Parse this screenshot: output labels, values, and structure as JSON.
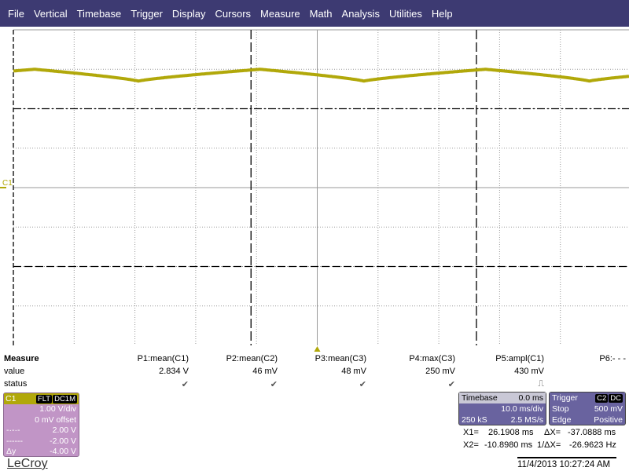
{
  "menu": [
    "File",
    "Vertical",
    "Timebase",
    "Trigger",
    "Display",
    "Cursors",
    "Measure",
    "Math",
    "Analysis",
    "Utilities",
    "Help"
  ],
  "trace": {
    "label": "C1",
    "color": "#b1a80a",
    "volts_per_div": 1.0,
    "ms_per_div": 10.0,
    "peak_v": 3.0,
    "min_v": 2.7,
    "period_ms": 37.1
  },
  "measure": {
    "title": "Measure",
    "value_label": "value",
    "status_label": "status",
    "params": [
      {
        "name": "P1:mean(C1)",
        "value": "2.834 V",
        "status": "✔"
      },
      {
        "name": "P2:mean(C2)",
        "value": "46 mV",
        "status": "✔"
      },
      {
        "name": "P3:mean(C3)",
        "value": "48 mV",
        "status": "✔"
      },
      {
        "name": "P4:max(C3)",
        "value": "250 mV",
        "status": "✔"
      },
      {
        "name": "P5:ampl(C1)",
        "value": "430 mV",
        "status": "⎍"
      },
      {
        "name": "P6:- - -",
        "value": "",
        "status": ""
      }
    ]
  },
  "channel": {
    "name": "C1",
    "badge1": "FLT",
    "badge2": "DC1M",
    "vdiv": "1.00 V/div",
    "offset": "0 mV offset",
    "c1_sym": "-·-·-",
    "c1": "2.00 V",
    "c2_sym": "------",
    "c2": "-2.00 V",
    "dy_label": "Δy",
    "dy": "-4.00 V"
  },
  "timebase": {
    "title": "Timebase",
    "delay": "0.0 ms",
    "tdiv": "10.0 ms/div",
    "samples": "250 kS",
    "rate": "2.5 MS/s"
  },
  "trigger": {
    "title": "Trigger",
    "src": "C2",
    "coupling": "DC",
    "mode": "Stop",
    "level": "500 mV",
    "type": "Edge",
    "slope": "Positive"
  },
  "cursors": {
    "x1_label": "X1=",
    "x1": "26.1908 ms",
    "dx_label": "ΔX=",
    "dx": "-37.0888 ms",
    "x2_label": "X2=",
    "x2": "-10.8980 ms",
    "inv_label": "1/ΔX=",
    "inv": "-26.9623 Hz"
  },
  "brand": "LeCroy",
  "datetime": "11/4/2013 10:27:24 AM"
}
